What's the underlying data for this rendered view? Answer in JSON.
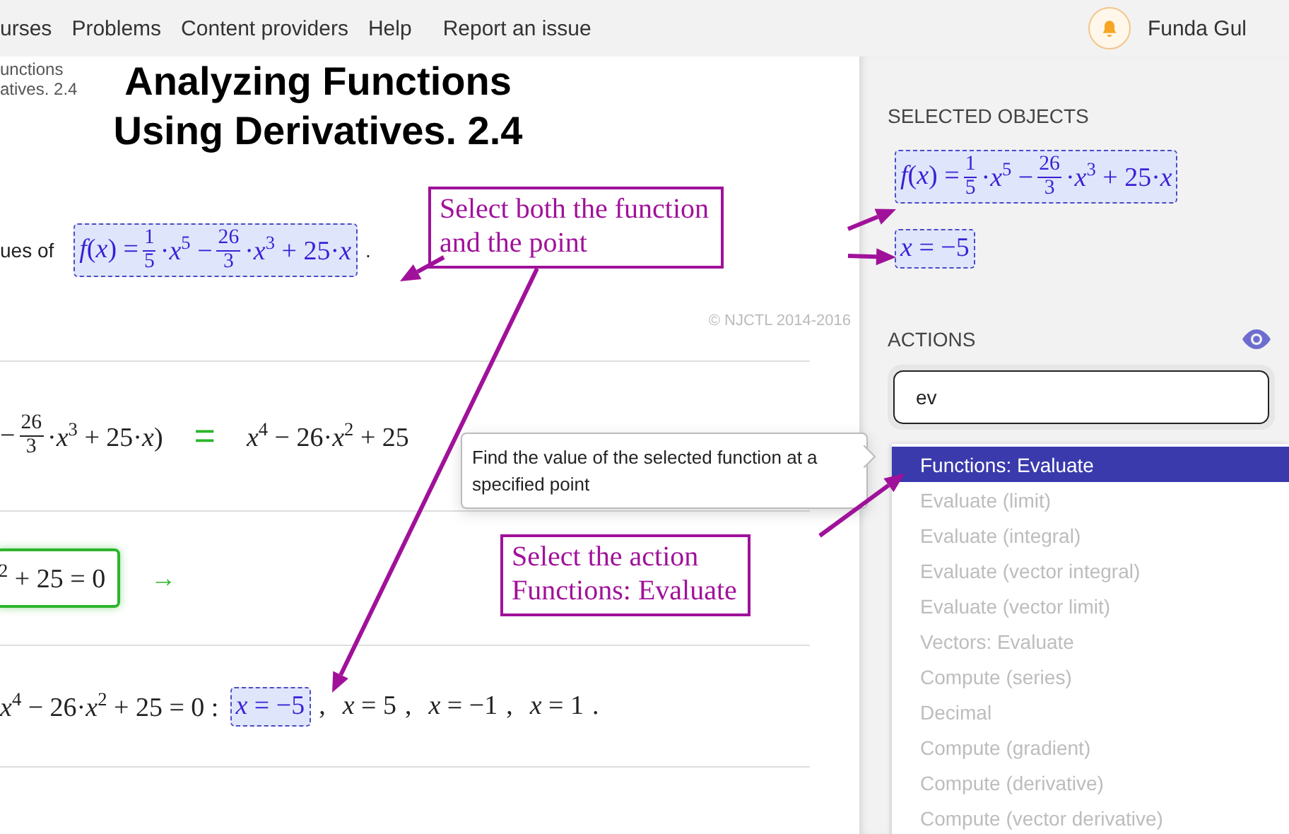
{
  "nav": {
    "links": [
      "urses",
      "Problems",
      "Content providers",
      "Help",
      "Report an issue"
    ],
    "user": "Funda Gul"
  },
  "breadcrumb": [
    "unctions",
    "atives. 2.4"
  ],
  "title": [
    "Analyzing Functions",
    "Using Derivatives. 2.4"
  ],
  "intro": {
    "text": "ues of",
    "expr": [
      "*f*(*x*) = ",
      {
        "num": "1",
        "den": "5"
      },
      "·*x*$^{5}$ − ",
      {
        "num": "26",
        "den": "3"
      },
      "·*x*$^{3}$ + 25·*x*"
    ],
    "selected": true,
    "end": "."
  },
  "copyright": "© NJCTL 2014-2016",
  "steps": [
    {
      "kind": "equation",
      "left": [
        "− ",
        {
          "num": "26",
          "den": "3"
        },
        "·*x*$^{3}$ + 25·*x*)"
      ],
      "relation": "=",
      "right": [
        "*x*$^{4}$ − 26·*x*$^{2}$ + 25"
      ]
    },
    {
      "kind": "boxed",
      "expr": [
        "$^{2}$ + 25 = 0"
      ],
      "arrow": "→"
    },
    {
      "kind": "solutions",
      "expr": [
        "*x*$^{4}$ − 26·*x*$^{2}$ + 25 = 0 :"
      ],
      "solutions": [
        {
          "expr": [
            "*x* = −5"
          ],
          "selected": true,
          "sep": ","
        },
        {
          "expr": [
            "*x* = 5"
          ],
          "selected": false,
          "sep": ","
        },
        {
          "expr": [
            "*x* = −1"
          ],
          "selected": false,
          "sep": ","
        },
        {
          "expr": [
            "*x* = 1"
          ],
          "selected": false,
          "sep": "."
        }
      ]
    }
  ],
  "sidebar": {
    "selected_heading": "SELECTED OBJECTS",
    "selected_objects": [
      [
        "*f*(*x*) = ",
        {
          "num": "1",
          "den": "5"
        },
        "·*x*$^{5}$ − ",
        {
          "num": "26",
          "den": "3"
        },
        "·*x*$^{3}$ + 25·*x*"
      ],
      [
        "*x* = −5"
      ]
    ],
    "actions_heading": "ACTIONS",
    "search_value": "ev",
    "actions": [
      {
        "label": "Functions: Evaluate",
        "selected": true
      },
      {
        "label": "Evaluate (limit)",
        "selected": false
      },
      {
        "label": "Evaluate (integral)",
        "selected": false
      },
      {
        "label": "Evaluate (vector integral)",
        "selected": false
      },
      {
        "label": "Evaluate (vector limit)",
        "selected": false
      },
      {
        "label": "Vectors: Evaluate",
        "selected": false
      },
      {
        "label": "Compute (series)",
        "selected": false
      },
      {
        "label": "Decimal",
        "selected": false
      },
      {
        "label": "Compute (gradient)",
        "selected": false
      },
      {
        "label": "Compute (derivative)",
        "selected": false
      },
      {
        "label": "Compute (vector derivative)",
        "selected": false
      }
    ]
  },
  "tooltip": "Find the value of the selected function at a specified point",
  "annotations": [
    {
      "lines": [
        "Select both the function",
        "and the point"
      ]
    },
    {
      "lines": [
        "Select the action",
        "Functions: Evaluate"
      ]
    }
  ]
}
